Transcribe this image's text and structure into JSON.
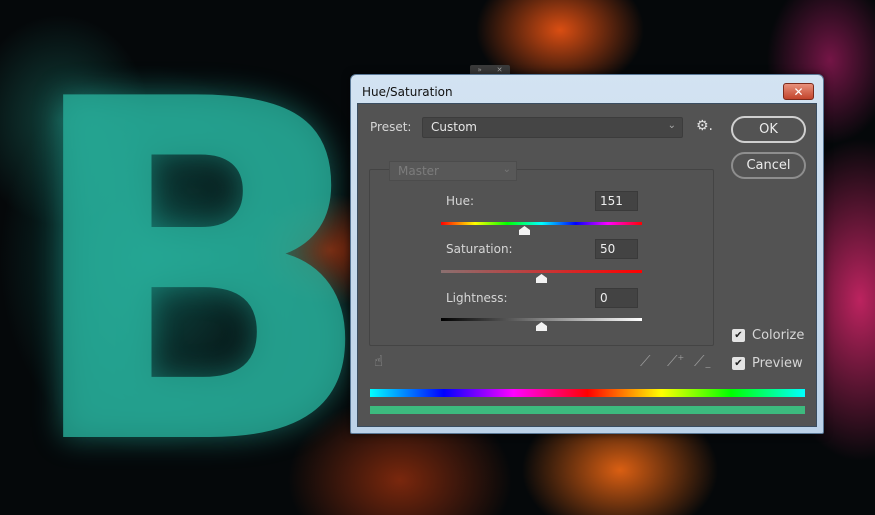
{
  "background": {
    "letter": "B",
    "description": "artwork-canvas"
  },
  "dialog": {
    "title": "Hue/Saturation",
    "close_glyph": "✕",
    "preset": {
      "label": "Preset:",
      "value": "Custom"
    },
    "settings_icon": "gear-icon",
    "buttons": {
      "ok": "OK",
      "cancel": "Cancel"
    },
    "channel": {
      "value": "Master"
    },
    "sliders": {
      "hue": {
        "label": "Hue:",
        "value": "151",
        "range": [
          0,
          360
        ],
        "position_fraction": 0.42
      },
      "saturation": {
        "label": "Saturation:",
        "value": "50",
        "range": [
          0,
          100
        ],
        "position_fraction": 0.5
      },
      "lightness": {
        "label": "Lightness:",
        "value": "0",
        "range": [
          -100,
          100
        ],
        "position_fraction": 0.5
      }
    },
    "checkboxes": {
      "colorize": {
        "label": "Colorize",
        "checked": true
      },
      "preview": {
        "label": "Preview",
        "checked": true
      }
    },
    "tools": [
      "targeted-adjustment-hand-icon",
      "eyedropper-icon",
      "eyedropper-add-icon",
      "eyedropper-subtract-icon"
    ],
    "result_color": "#3dba7e",
    "accent_colors": {
      "hue_track_end": "#ff0000",
      "saturation_track_end": "#ff0000"
    }
  }
}
